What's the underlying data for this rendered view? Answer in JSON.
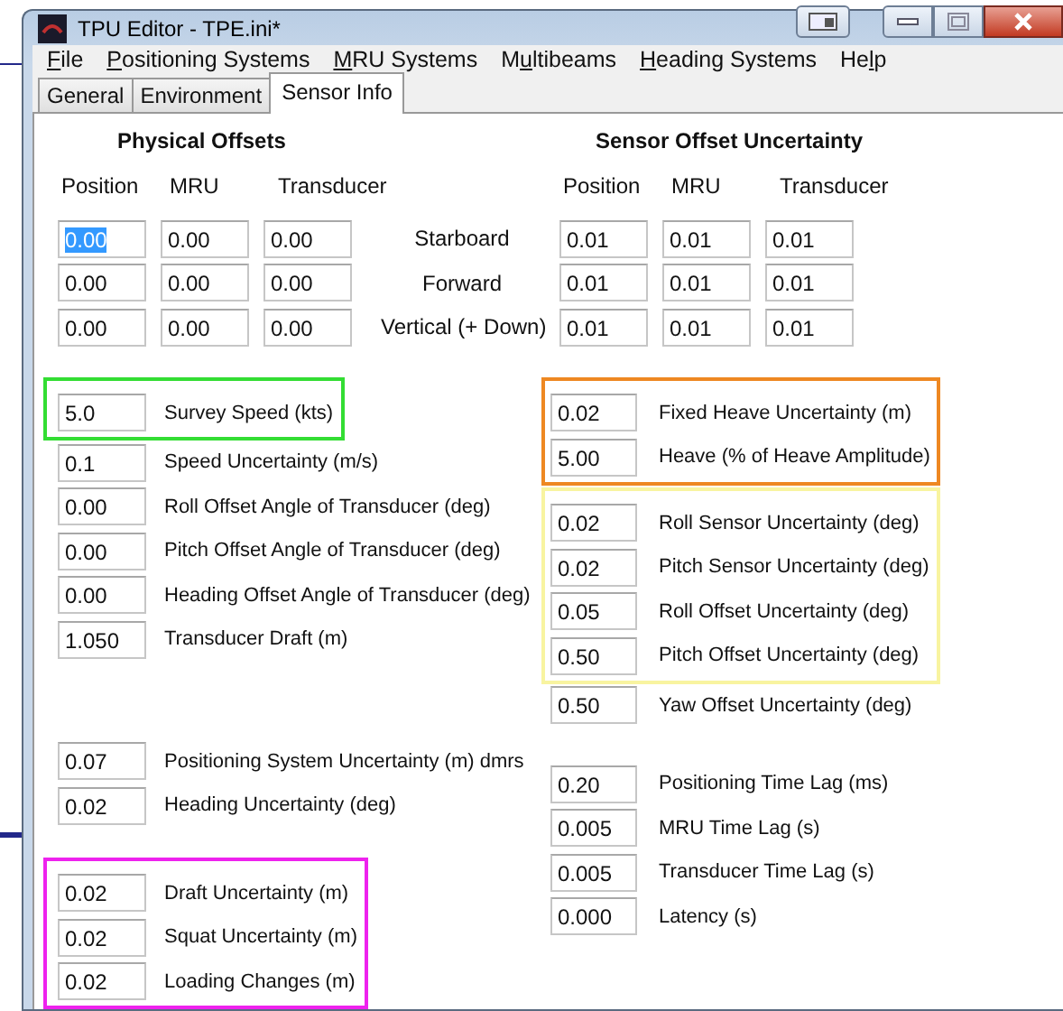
{
  "window": {
    "title": "TPU Editor - TPE.ini*"
  },
  "menu": [
    {
      "segments": [
        {
          "text": "F",
          "underlined": true
        },
        {
          "text": "ile",
          "underlined": false
        }
      ]
    },
    {
      "segments": [
        {
          "text": "P",
          "underlined": true
        },
        {
          "text": "ositioning Systems",
          "underlined": false
        }
      ]
    },
    {
      "segments": [
        {
          "text": "M",
          "underlined": true
        },
        {
          "text": "RU Systems",
          "underlined": false
        }
      ]
    },
    {
      "segments": [
        {
          "text": "M",
          "underlined": false
        },
        {
          "text": "u",
          "underlined": true
        },
        {
          "text": "ltibeams",
          "underlined": false
        }
      ]
    },
    {
      "segments": [
        {
          "text": "H",
          "underlined": true
        },
        {
          "text": "eading Systems",
          "underlined": false
        }
      ]
    },
    {
      "segments": [
        {
          "text": "He",
          "underlined": false
        },
        {
          "text": "l",
          "underlined": true
        },
        {
          "text": "p",
          "underlined": false
        }
      ]
    }
  ],
  "tabs": [
    {
      "label": "General",
      "selected": false
    },
    {
      "label": "Environment",
      "selected": false
    },
    {
      "label": "Sensor Info",
      "selected": true
    }
  ],
  "physical_offsets": {
    "title": "Physical Offsets",
    "columns": [
      "Position",
      "MRU",
      "Transducer"
    ],
    "rows": [
      {
        "label": "Starboard",
        "values": [
          {
            "text": "0.00",
            "selected": true
          },
          {
            "text": "0.00",
            "selected": false
          },
          {
            "text": "0.00",
            "selected": false
          }
        ]
      },
      {
        "label": "Forward",
        "values": [
          {
            "text": "0.00",
            "selected": false
          },
          {
            "text": "0.00",
            "selected": false
          },
          {
            "text": "0.00",
            "selected": false
          }
        ]
      },
      {
        "label": "Vertical (+ Down)",
        "values": [
          {
            "text": "0.00",
            "selected": false
          },
          {
            "text": "0.00",
            "selected": false
          },
          {
            "text": "0.00",
            "selected": false
          }
        ]
      }
    ]
  },
  "sensor_offset_uncertainty": {
    "title": "Sensor Offset Uncertainty",
    "columns": [
      "Position",
      "MRU",
      "Transducer"
    ],
    "rows": [
      [
        "0.01",
        "0.01",
        "0.01"
      ],
      [
        "0.01",
        "0.01",
        "0.01"
      ],
      [
        "0.01",
        "0.01",
        "0.01"
      ]
    ]
  },
  "left_groups": [
    {
      "color": "#33dd33",
      "fields": [
        {
          "value": "5.0",
          "label": "Survey Speed (kts)"
        }
      ]
    },
    {
      "fields": [
        {
          "value": "0.1",
          "label": "Speed Uncertainty (m/s)"
        },
        {
          "value": "0.00",
          "label": "Roll Offset Angle of Transducer (deg)"
        },
        {
          "value": "0.00",
          "label": "Pitch Offset Angle of Transducer (deg)"
        },
        {
          "value": "0.00",
          "label": "Heading Offset Angle of Transducer (deg)"
        },
        {
          "value": "1.050",
          "label": "Transducer Draft (m)"
        }
      ]
    },
    {
      "fields": [
        {
          "value": "0.07",
          "label": "Positioning System Uncertainty (m) dmrs"
        },
        {
          "value": "0.02",
          "label": "Heading Uncertainty (deg)"
        }
      ]
    },
    {
      "color": "#ee22ee",
      "fields": [
        {
          "value": "0.02",
          "label": "Draft Uncertainty (m)"
        },
        {
          "value": "0.02",
          "label": "Squat Uncertainty (m)"
        },
        {
          "value": "0.02",
          "label": "Loading Changes (m)"
        }
      ]
    }
  ],
  "right_groups": [
    {
      "color": "#ee8822",
      "fields": [
        {
          "value": "0.02",
          "label": "Fixed Heave Uncertainty (m)"
        },
        {
          "value": "5.00",
          "label": "Heave (% of Heave Amplitude)"
        }
      ]
    },
    {
      "color": "#f8f4a0",
      "fields": [
        {
          "value": "0.02",
          "label": "Roll Sensor Uncertainty (deg)"
        },
        {
          "value": "0.02",
          "label": "Pitch Sensor Uncertainty (deg)"
        },
        {
          "value": "0.05",
          "label": "Roll Offset Uncertainty (deg)"
        },
        {
          "value": "0.50",
          "label": "Pitch Offset Uncertainty (deg)"
        }
      ]
    },
    {
      "fields": [
        {
          "value": "0.50",
          "label": "Yaw Offset Uncertainty (deg)"
        }
      ]
    },
    {
      "fields": [
        {
          "value": "0.20",
          "label": "Positioning Time Lag (ms)"
        },
        {
          "value": "0.005",
          "label": "MRU Time Lag (s)"
        },
        {
          "value": "0.005",
          "label": "Transducer Time Lag (s)"
        },
        {
          "value": "0.000",
          "label": "Latency (s)"
        }
      ]
    }
  ]
}
